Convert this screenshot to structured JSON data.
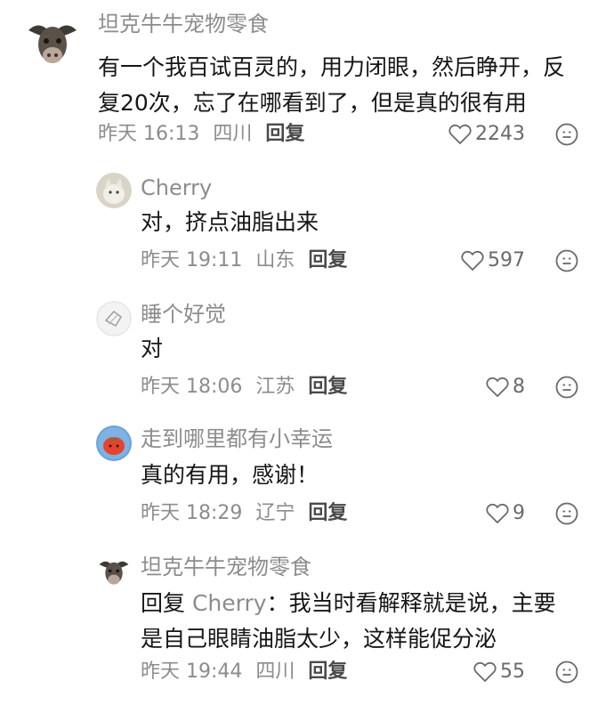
{
  "comments": [
    {
      "username": "坦克牛牛宠物零食",
      "text_line1": "有一个我百试百灵的，用力闭眼，然后睁开，反",
      "text_line2": "复20次，忘了在哪看到了，但是真的很有用",
      "time": "昨天 16:13",
      "location": "四川",
      "reply_label": "回复",
      "likes": "2243",
      "avatar_icon": "buffalo-avatar"
    },
    {
      "username": "Cherry",
      "text_line1": "对，挤点油脂出来",
      "time": "昨天 19:11",
      "location": "山东",
      "reply_label": "回复",
      "likes": "597",
      "avatar_icon": "cat-avatar"
    },
    {
      "username": "睡个好觉",
      "text_line1": "对",
      "time": "昨天 18:06",
      "location": "江苏",
      "reply_label": "回复",
      "likes": "8",
      "avatar_icon": "sketch-avatar"
    },
    {
      "username": "走到哪里都有小幸运",
      "text_line1": "真的有用，感谢！",
      "time": "昨天 18:29",
      "location": "辽宁",
      "reply_label": "回复",
      "likes": "9",
      "avatar_icon": "tomato-avatar"
    },
    {
      "username": "坦克牛牛宠物零食",
      "reply_prefix": "回复",
      "reply_target": "Cherry",
      "text_line1_rest": "：我当时看解释就是说，主要",
      "text_line2": "是自己眼睛油脂太少，这样能促分泌",
      "time": "昨天 19:44",
      "location": "四川",
      "reply_label": "回复",
      "likes": "55",
      "avatar_icon": "buffalo-avatar"
    }
  ],
  "colors": {
    "muted": "#8c8c8c",
    "text": "#161616",
    "reply": "#4a4a4a"
  }
}
